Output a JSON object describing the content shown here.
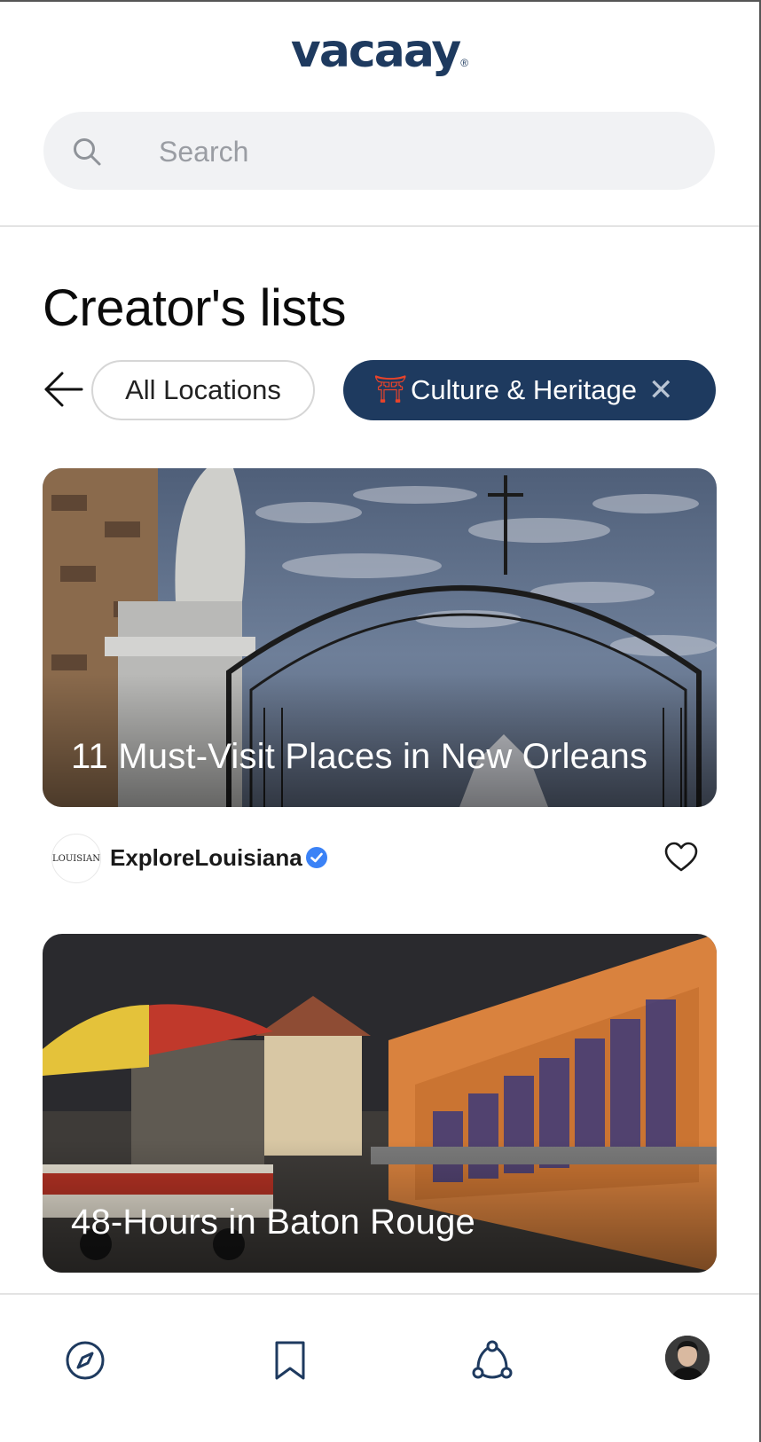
{
  "app": {
    "logo": "vacaay",
    "logo_mark": "®"
  },
  "search": {
    "placeholder": "Search"
  },
  "page": {
    "title": "Creator's lists"
  },
  "filters": {
    "location_chip": "All Locations",
    "active_chip": {
      "emoji": "⛩",
      "label": "Culture & Heritage",
      "close": "✕"
    }
  },
  "lists": [
    {
      "title": "11 Must-Visit Places in New Orleans",
      "creator": {
        "name": "ExploreLouisiana",
        "avatar_text": "LOUISIANA",
        "verified": true
      },
      "liked": false
    },
    {
      "title": "48-Hours in Baton Rouge"
    }
  ],
  "colors": {
    "brand": "#1e3a5f",
    "search_bg": "#f1f2f4",
    "verified": "#3b82f6"
  },
  "nav": {
    "items": [
      "explore-icon",
      "bookmark-icon",
      "community-icon",
      "profile-avatar"
    ]
  }
}
